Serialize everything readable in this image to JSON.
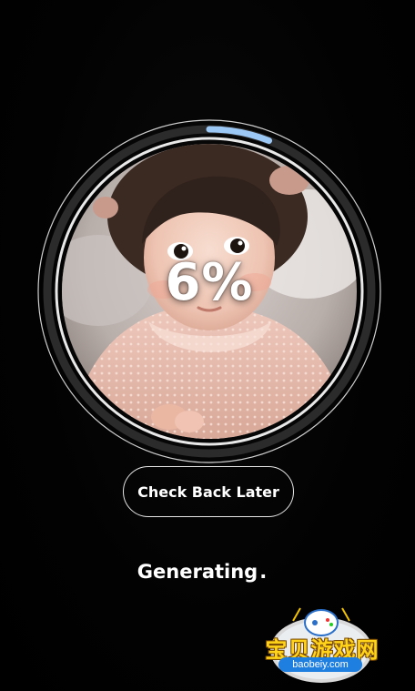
{
  "progress": {
    "percent_text": "6%",
    "value": 0.06
  },
  "buttons": {
    "check_back_label": "Check Back Later"
  },
  "status": {
    "label": "Generating",
    "dots": "."
  },
  "watermark": {
    "text": "宝贝游戏网",
    "url": "baobeiy.com"
  },
  "colors": {
    "background": "#000000",
    "ring_track": "#2b2b2b",
    "ring_progress": "#9cc8f5",
    "text": "#ffffff"
  },
  "icons": [
    "gamepad-icon"
  ]
}
